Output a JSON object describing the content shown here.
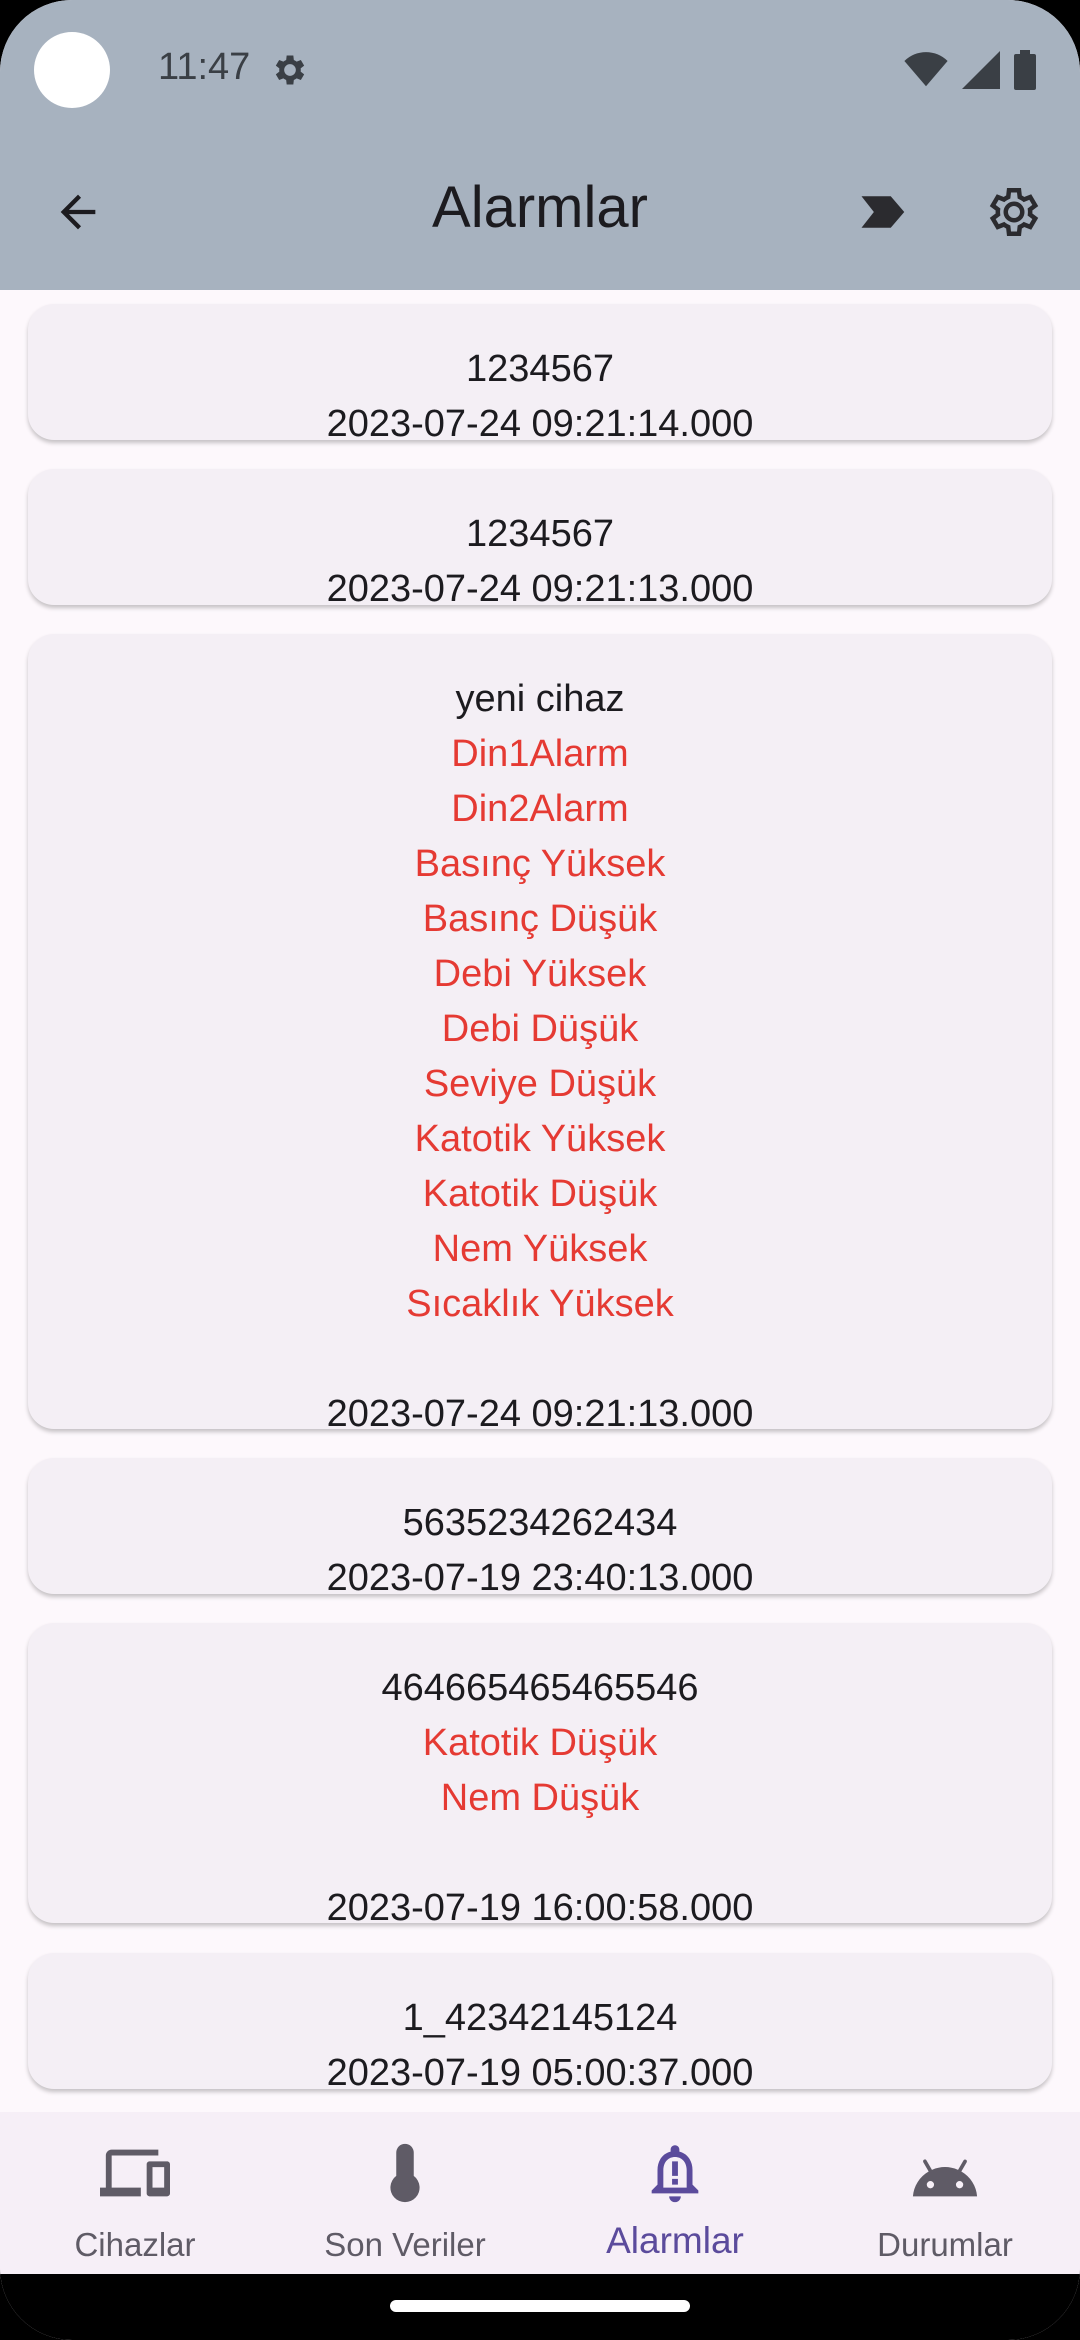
{
  "status_bar": {
    "time": "11:47"
  },
  "app_bar": {
    "title": "Alarmlar",
    "back_icon": "arrow-back-icon",
    "label_icon": "label-icon",
    "settings_icon": "settings-icon"
  },
  "alarms": [
    {
      "device": "1234567",
      "alarms": [],
      "timestamp": "2023-07-24 09:21:14.000"
    },
    {
      "device": "1234567",
      "alarms": [],
      "timestamp": "2023-07-24 09:21:13.000"
    },
    {
      "device": "yeni cihaz",
      "alarms": [
        "Din1Alarm",
        "Din2Alarm",
        "Basınç Yüksek",
        "Basınç Düşük",
        "Debi Yüksek",
        "Debi Düşük",
        "Seviye Düşük",
        "Katotik Yüksek",
        "Katotik Düşük",
        "Nem Yüksek",
        "Sıcaklık Yüksek"
      ],
      "timestamp": "2023-07-24 09:21:13.000"
    },
    {
      "device": "5635234262434",
      "alarms": [],
      "timestamp": "2023-07-19 23:40:13.000"
    },
    {
      "device": "464665465465546",
      "alarms": [
        "Katotik Düşük",
        "Nem Düşük"
      ],
      "timestamp": "2023-07-19 16:00:58.000"
    },
    {
      "device": "1_42342145124",
      "alarms": [],
      "timestamp": "2023-07-19 05:00:37.000"
    }
  ],
  "bottom_nav": [
    {
      "label": "Cihazlar",
      "icon": "devices-icon",
      "active": false
    },
    {
      "label": "Son Veriler",
      "icon": "thermometer-icon",
      "active": false
    },
    {
      "label": "Alarmlar",
      "icon": "alarm-bell-icon",
      "active": true
    },
    {
      "label": "Durumlar",
      "icon": "android-icon",
      "active": false
    }
  ],
  "colors": {
    "app_bar": "#a7b2bf",
    "alarm_text": "#e53a33",
    "active_nav": "#5b4b9c",
    "card_bg": "#f4eff5"
  }
}
